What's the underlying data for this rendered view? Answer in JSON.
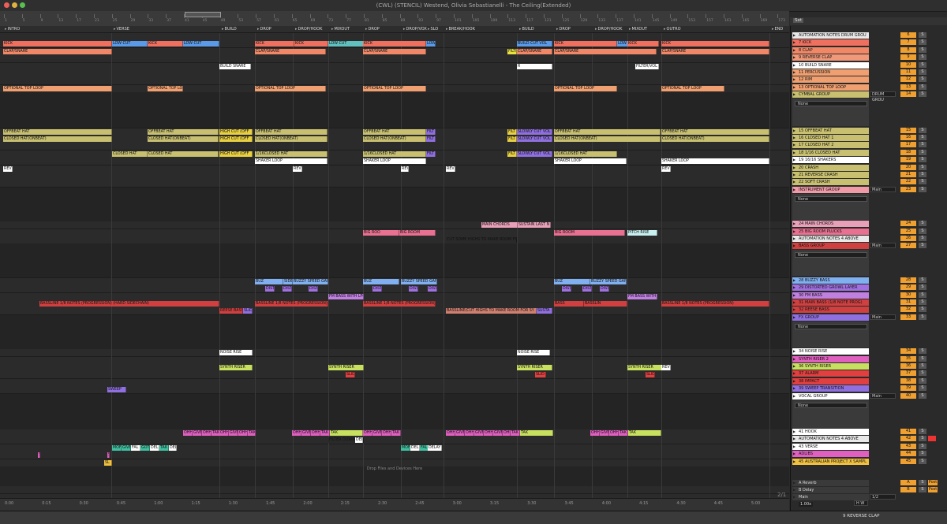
{
  "title": "(CWL) (STENCIL) Westend, Olivia Sebastianelli - The Ceiling(Extended)",
  "ruler": {
    "bars": [
      "1",
      "5",
      "9",
      "13",
      "17",
      "21",
      "25",
      "29",
      "33",
      "37",
      "41",
      "45",
      "49",
      "53",
      "57",
      "61",
      "65",
      "69",
      "73",
      "77",
      "81",
      "85",
      "89",
      "93",
      "97",
      "101",
      "105",
      "109",
      "113",
      "117",
      "121",
      "125",
      "129",
      "133",
      "137",
      "141",
      "145",
      "149",
      "153",
      "157",
      "161",
      "165",
      "169",
      "173"
    ]
  },
  "locators": [
    "INTRO",
    "VERSE",
    "BUILD",
    "DROP",
    "DROP/HOOK",
    "MIXOUT",
    "DROP",
    "DROP/VOX",
    "BREAK/HOOK",
    "BUILD",
    "DROP",
    "DROP/HOOK",
    "MIXOUT",
    "OUTRO",
    "END",
    "SLO"
  ],
  "time_labels": [
    "0:00",
    "0:15",
    "0:30",
    "0:45",
    "1:00",
    "1:15",
    "1:30",
    "1:45",
    "2:00",
    "2:15",
    "2:30",
    "2:45",
    "3:00",
    "3:15",
    "3:30",
    "3:45",
    "4:00",
    "4:15",
    "4:30",
    "4:45",
    "5:00"
  ],
  "clips": [
    "LOW CUT",
    "KICK",
    "CLAP/SNARE",
    "BUILD SNARE",
    "FILTER/VOL",
    "OPTIONAL TOP LOOP",
    "OFFBEAT HAT",
    "CLOSED HAT(ONBEAT)",
    "CLOSED HAT",
    "HIGH CUT (OFF",
    "SHAKER LOOP",
    "1/16CLOSED HAT",
    "SLOWLY CUT VOL",
    "REV",
    "BIG ROO",
    "BIG ROOM",
    "CUT SOME HIGHS TO MAKE ROOM FOR",
    "MAIN CHORDS",
    "SUSTAIN LAST N",
    "PITCH RISE",
    "BUZ",
    "SIDE",
    "BUZZY SPEED GAR",
    "DIST",
    "FM BASS WITH LFO",
    "FM BASS WITH",
    "BASSLINE 1/8 NOTES (PROGRESSION) (HARD SIDECHAIN)",
    "BASSLINE 1/8 NOTES (PROGRESSION)",
    "BASS",
    "BASSLIN",
    "REESE BASS",
    "SLID",
    "BASSLINE(CUT HIGHS TO MAKE ROOM FOR SY",
    "SUSTA",
    "NOISE RISE",
    "SYNTH RISER",
    "SWEEP",
    "OHH",
    "GIVE",
    "TAK",
    "FILTER DOWN",
    "DELAY",
    "MOF",
    "FAL",
    "GOT",
    "DEL",
    "BUILD CUT VOL",
    "FILTE",
    "OFFBEAT HAT",
    "CLOSED HAT(ONBEAT)",
    "BUILD SNARE(I",
    "R",
    "FILT",
    "BUILD SNARE",
    "CLAP/SNARE",
    "SL"
  ],
  "drop_hint": "Drop Files and Devices Here",
  "page_indicator": "2/1",
  "mixer_label": "Set",
  "tracks": [
    {
      "name": "AUTOMATION NOTES DRUM GROU",
      "num": "6",
      "color": "#e8e8e8"
    },
    {
      "name": "7 KICK",
      "num": "7",
      "color": "#f07060"
    },
    {
      "name": "8 CLAP",
      "num": "8",
      "color": "#f08868"
    },
    {
      "name": "9 REVERSE CLAP",
      "num": "9",
      "color": "#f09878"
    },
    {
      "name": "10 BUILD SNARE",
      "num": "10",
      "color": "#ffffff"
    },
    {
      "name": "11 PERCUSSION",
      "num": "11",
      "color": "#f0a070"
    },
    {
      "name": "12 RIM",
      "num": "12",
      "color": "#f0a070"
    },
    {
      "name": "13 OPTIONAL TOP LOOP",
      "num": "13",
      "color": "#f0a070"
    },
    {
      "name": "CYMBAL GROUP",
      "num": "14",
      "color": "#c8c070",
      "group": true,
      "routing": "DRUM GROU"
    },
    {
      "name": "15 OFFBEAT HAT",
      "num": "15",
      "color": "#c8c070"
    },
    {
      "name": "16 CLOSED HAT 1",
      "num": "16",
      "color": "#c8c070"
    },
    {
      "name": "17 CLOSED HAT 2",
      "num": "17",
      "color": "#c8c070"
    },
    {
      "name": "18 1/16 CLOSED HAT",
      "num": "18",
      "color": "#c8c070"
    },
    {
      "name": "19 16/16 SHAKERS",
      "num": "19",
      "color": "#ffffff"
    },
    {
      "name": "20 CRASH",
      "num": "20",
      "color": "#c8c070"
    },
    {
      "name": "21 REVERSE CRASH",
      "num": "21",
      "color": "#c8c070"
    },
    {
      "name": "22 SOFT CRASH",
      "num": "22",
      "color": "#c8c070"
    },
    {
      "name": "INSTRUMENT GROUP",
      "num": "23",
      "color": "#f09aa8",
      "group": true,
      "routing": "Main"
    },
    {
      "name": "24 MAIN CHORDS",
      "num": "24",
      "color": "#e8a0b8"
    },
    {
      "name": "25 BIG ROOM PLUCKS",
      "num": "25",
      "color": "#e87090"
    },
    {
      "name": "AUTOMATION NOTES 4 ABOVE",
      "num": "26",
      "color": "#e8e8e8"
    },
    {
      "name": "BASS GROUP",
      "num": "27",
      "color": "#d04040",
      "group": true,
      "routing": "Main"
    },
    {
      "name": "28 BUZZY BASS",
      "num": "28",
      "color": "#80b0f0"
    },
    {
      "name": "29 DISTORTED GROWL LAYER",
      "num": "29",
      "color": "#a070e0"
    },
    {
      "name": "30 FM BASS",
      "num": "30",
      "color": "#c080e0"
    },
    {
      "name": "31 MAIN BASS (1/8 NOTE PROG)",
      "num": "31",
      "color": "#d04040"
    },
    {
      "name": "32 REESE BASS",
      "num": "32",
      "color": "#d04040"
    },
    {
      "name": "FX GROUP",
      "num": "33",
      "color": "#9070e0",
      "group": true,
      "routing": "Main"
    },
    {
      "name": "34 NOISE RISE",
      "num": "34",
      "color": "#ffffff"
    },
    {
      "name": "SYNTH RISER 2",
      "num": "35",
      "color": "#e060c0"
    },
    {
      "name": "36 SYNTH RISER",
      "num": "36",
      "color": "#c8e060"
    },
    {
      "name": "37 ALARM",
      "num": "37",
      "color": "#e04040"
    },
    {
      "name": "38 IMPACT",
      "num": "38",
      "color": "#e04040"
    },
    {
      "name": "39 SWEEP TRANSITION",
      "num": "39",
      "color": "#9070e0"
    },
    {
      "name": "VOCAL GROUP",
      "num": "40",
      "color": "#ffffff",
      "group": true,
      "routing": "Main"
    },
    {
      "name": "41 HOOK",
      "num": "41",
      "color": "#ffffff"
    },
    {
      "name": "AUTOMATION NOTES 4 ABOVE",
      "num": "42",
      "color": "#e8e8e8"
    },
    {
      "name": "43 VERSE",
      "num": "43",
      "color": "#ffffff"
    },
    {
      "name": "ADLIBS",
      "num": "44",
      "color": "#e060c0"
    },
    {
      "name": "45 AUSTRALIAN PROJECT X SAMPL",
      "num": "45",
      "color": "#f0c040"
    }
  ],
  "returns": [
    {
      "name": "A Reverb",
      "letter": "A",
      "post": "Post"
    },
    {
      "name": "B Delay",
      "letter": "B",
      "post": "Post"
    },
    {
      "name": "Main",
      "letter": "",
      "post": ""
    }
  ],
  "group_none_label": "None",
  "s_label": "S",
  "main_ratio": "1/2",
  "hw_label": "H W",
  "zoom_value": "1.00x",
  "status_track": "9 REVERSE CLAP"
}
